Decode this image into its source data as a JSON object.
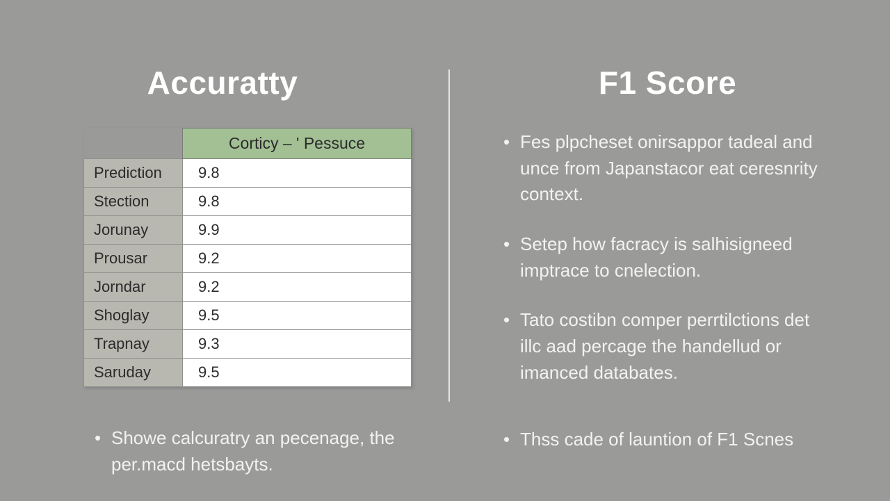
{
  "left": {
    "heading": "Accuratty",
    "table": {
      "header": "Corticy – ' Pessuce",
      "rows": [
        {
          "label": "Prediction",
          "value": "9.8"
        },
        {
          "label": "Stection",
          "value": "9.8"
        },
        {
          "label": "Jorunay",
          "value": "9.9"
        },
        {
          "label": "Prousar",
          "value": "9.2"
        },
        {
          "label": "Jorndar",
          "value": "9.2"
        },
        {
          "label": "Shoglay",
          "value": "9.5"
        },
        {
          "label": "Trapnay",
          "value": "9.3"
        },
        {
          "label": "Saruday",
          "value": "9.5"
        }
      ]
    },
    "bullets": [
      "Showe calcuratry an pecenage, the per.macd hetsbayts."
    ]
  },
  "right": {
    "heading": "F1 Score",
    "bullets": [
      "Fes plpcheset onirsappor tadeal and unce from Japanstacor eat ceresnrity context.",
      "Setep how facracy is salhisigneed imptrace to cnelection.",
      "Tato costibn comper perrtilctions det illc aad percage the handellud or imanced databates."
    ],
    "bullets_lower": [
      "Thss cade of launtion of F1 Scnes"
    ]
  },
  "chart_data": {
    "type": "table",
    "title": "Corticy – ' Pessuce",
    "categories": [
      "Prediction",
      "Stection",
      "Jorunay",
      "Prousar",
      "Jorndar",
      "Shoglay",
      "Trapnay",
      "Saruday"
    ],
    "values": [
      9.8,
      9.8,
      9.9,
      9.2,
      9.2,
      9.5,
      9.3,
      9.5
    ]
  }
}
